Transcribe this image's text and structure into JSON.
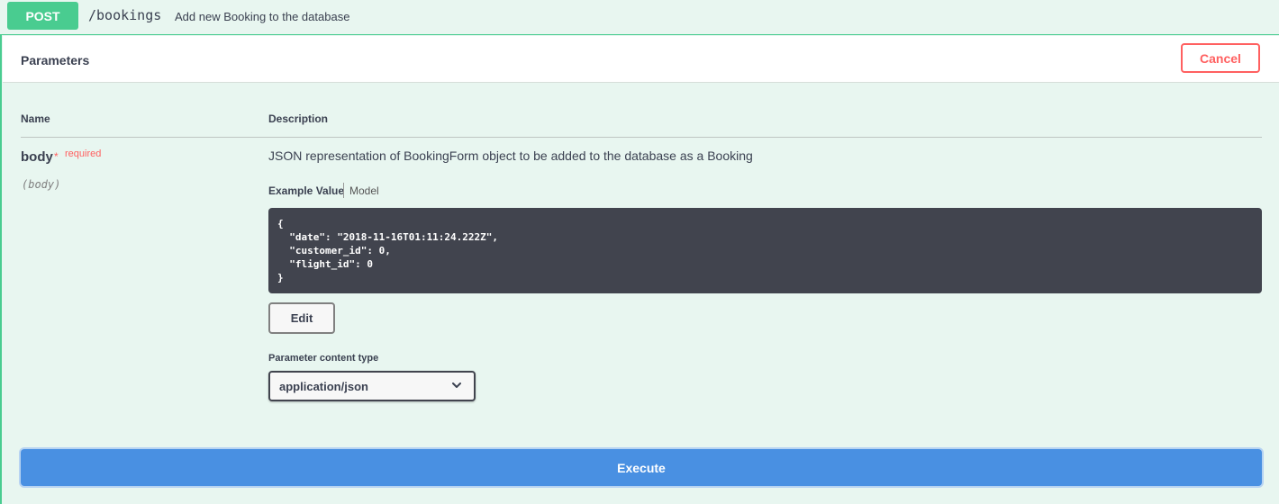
{
  "operation": {
    "method": "POST",
    "path": "/bookings",
    "summary": "Add new Booking to the database"
  },
  "parameters_section": {
    "title": "Parameters",
    "cancel_label": "Cancel"
  },
  "columns": {
    "name": "Name",
    "description": "Description"
  },
  "parameter": {
    "name": "body",
    "required_star": "*",
    "required_label": "required",
    "in": "(body)",
    "description": "JSON representation of BookingForm object to be added to the database as a Booking"
  },
  "tabs": {
    "example_value": "Example Value",
    "model": "Model"
  },
  "example_json": "{\n  \"date\": \"2018-11-16T01:11:24.222Z\",\n  \"customer_id\": 0,\n  \"flight_id\": 0\n}",
  "edit_label": "Edit",
  "content_type": {
    "label": "Parameter content type",
    "selected": "application/json"
  },
  "execute_label": "Execute",
  "colors": {
    "method_post": "#49cc90",
    "cancel": "#ff6060",
    "execute": "#4990e2",
    "code_bg": "#41444e",
    "panel_bg": "#e8f6f0"
  },
  "icons": {
    "select_arrow": "chevron-down-icon"
  }
}
